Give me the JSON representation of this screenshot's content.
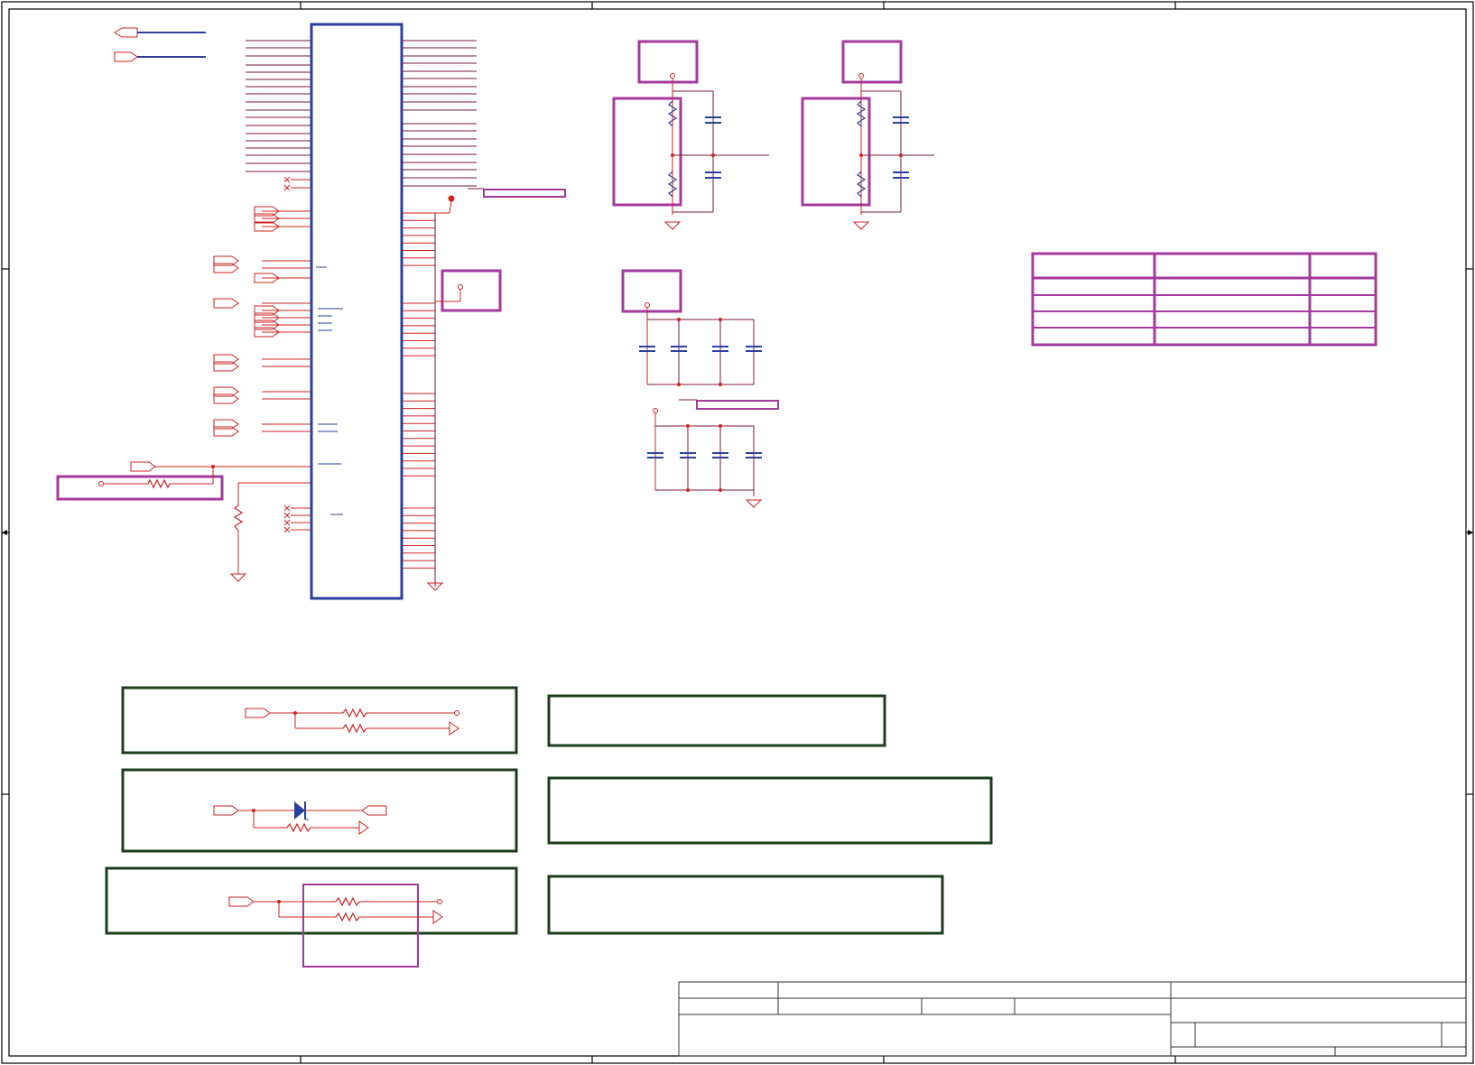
{
  "page": {
    "title": ""
  },
  "colors": {
    "wire": "#cc2222",
    "bus": "#7a1a3a",
    "chip_outline": "#2b3f9c",
    "block_outline": "#a43a9c",
    "note_outline": "#1c3d1c",
    "frame": "#000000"
  },
  "main_ic": {
    "left_pin_count": 52,
    "right_pin_count": 52
  },
  "power_blocks": [
    "regulator-block-1",
    "regulator-block-2",
    "decoupling-block-1",
    "decoupling-block-2"
  ],
  "strap_table": {
    "rows": 5,
    "columns": 3
  },
  "option_blocks": [
    "option-block-resistors",
    "option-block-diode",
    "option-block-resistor-pair"
  ],
  "note_boxes": [
    "note-box-1",
    "note-box-2",
    "note-box-3"
  ],
  "title_block": {
    "fields": []
  }
}
